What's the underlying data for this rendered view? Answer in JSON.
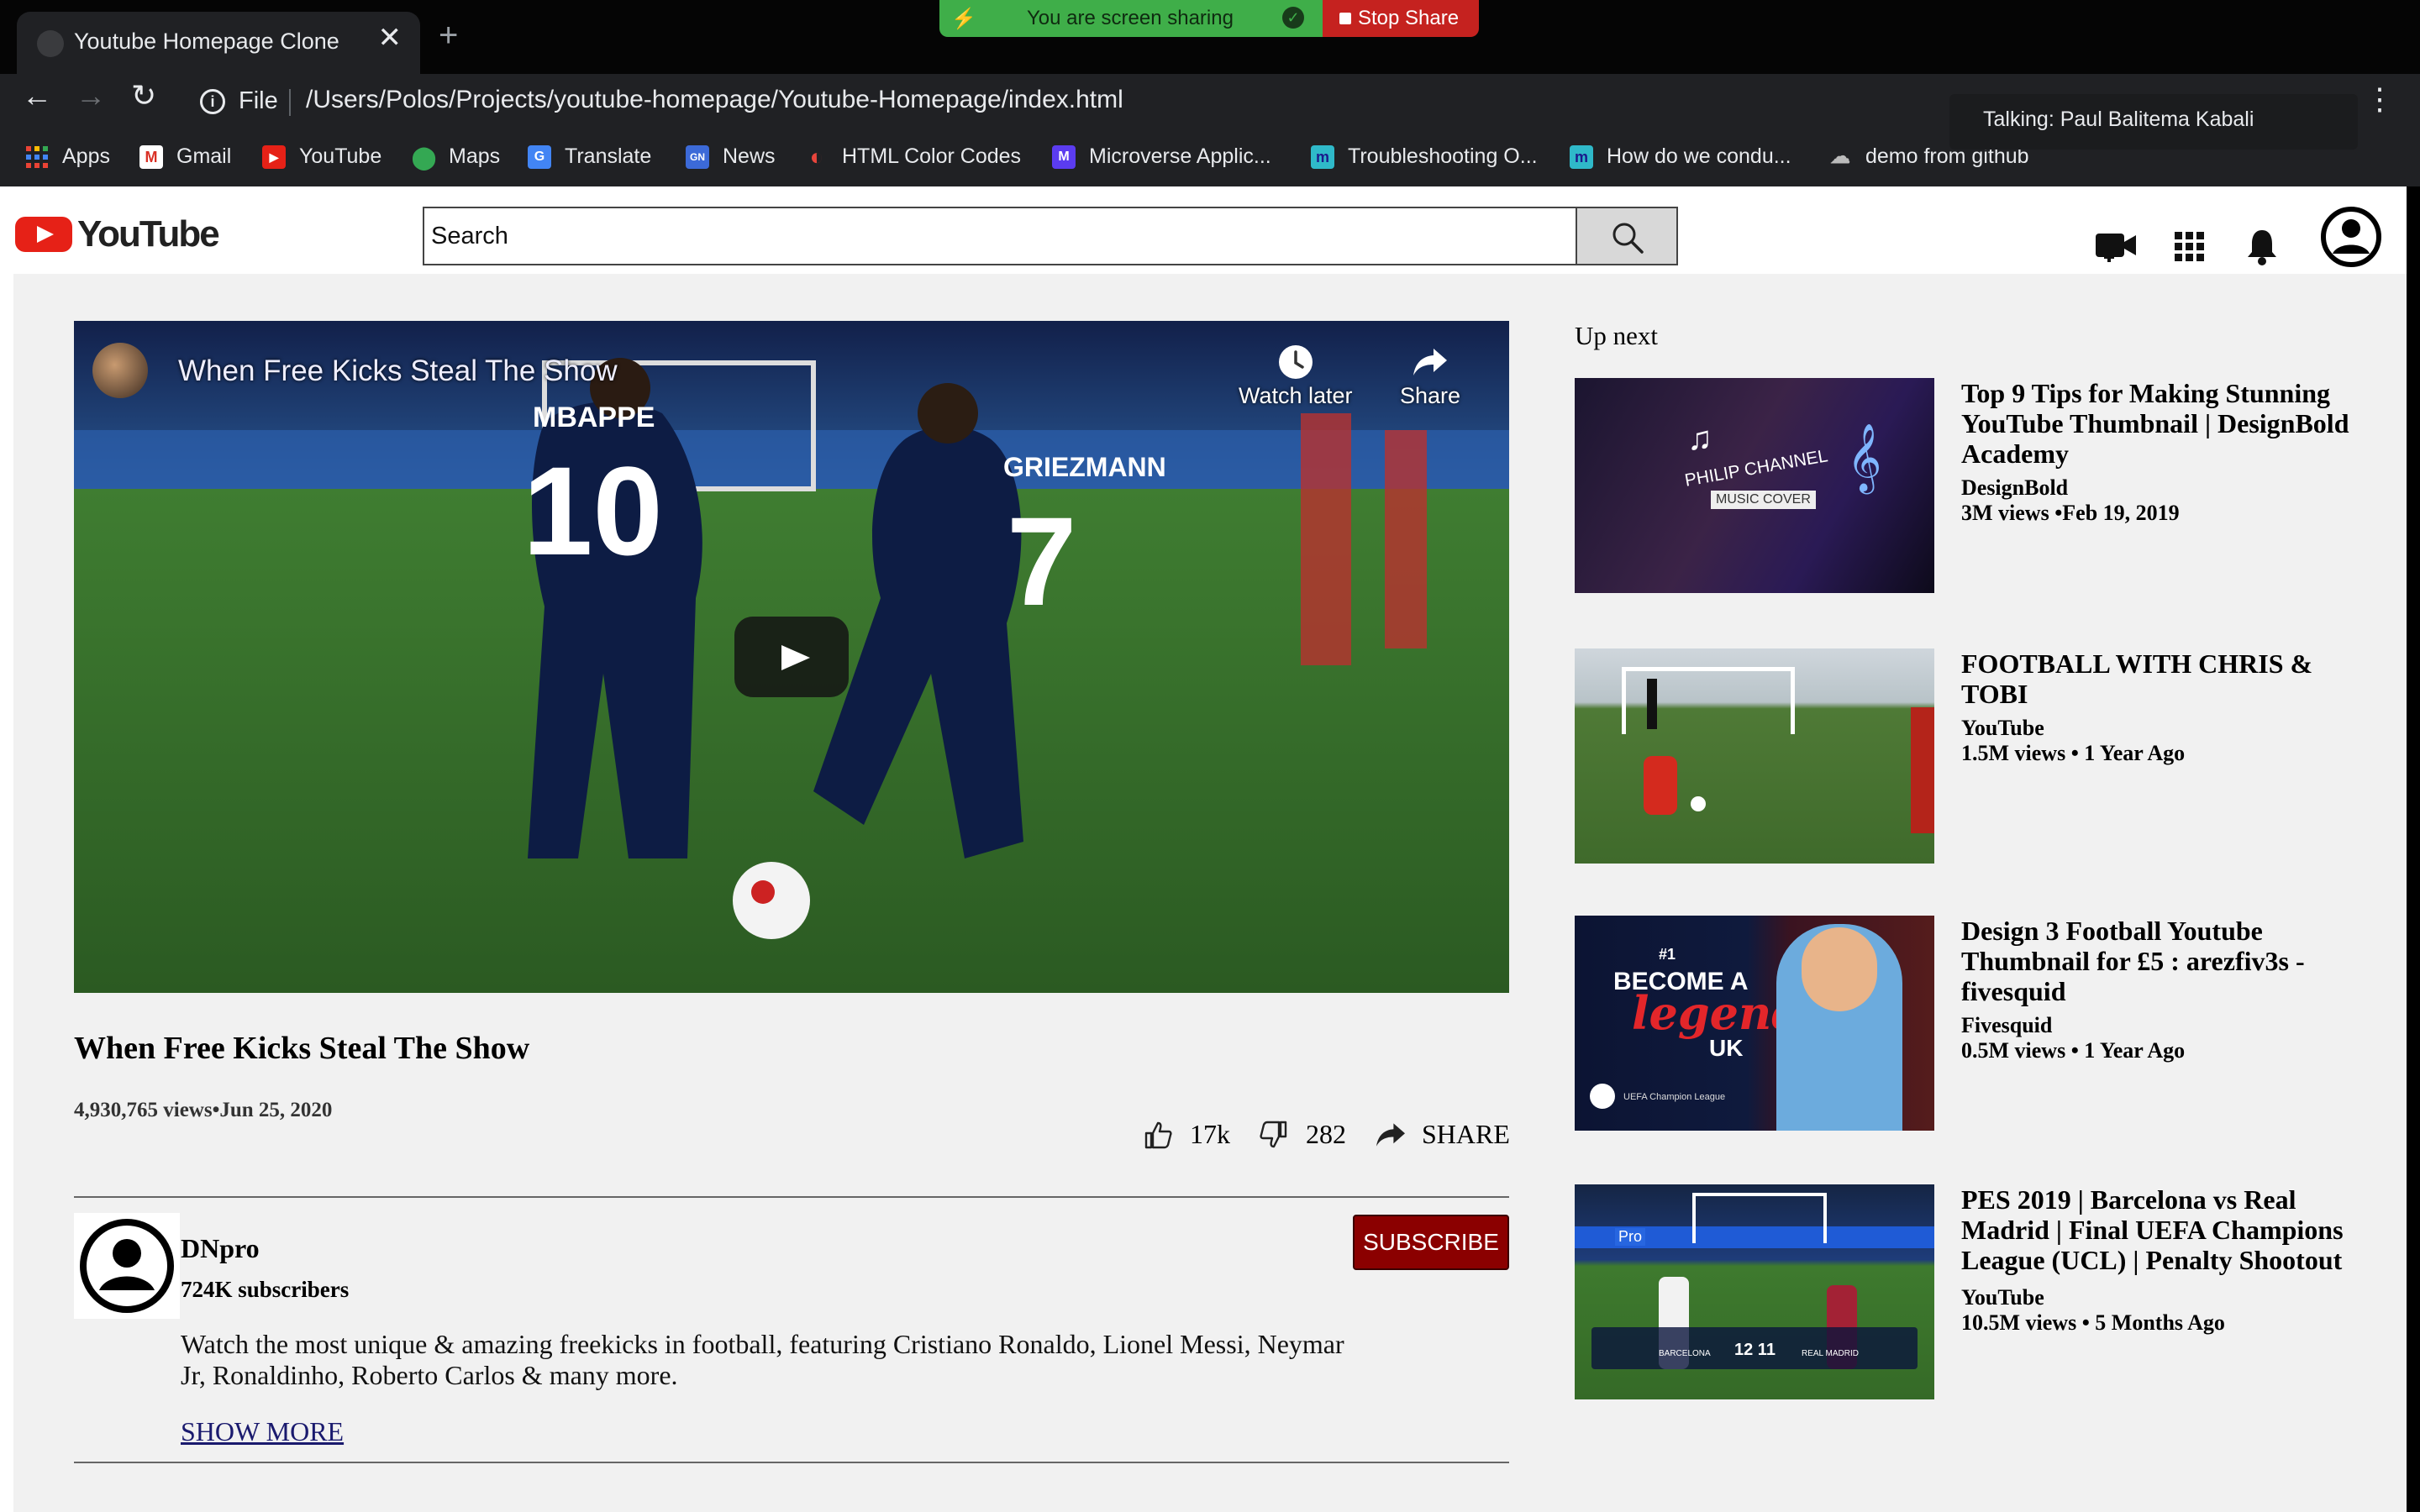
{
  "browser": {
    "tab_title": "Youtube Homepage Clone",
    "tab_close": "✕",
    "new_tab": "+",
    "file_label": "File",
    "url": "/Users/Polos/Projects/youtube-homepage/Youtube-Homepage/index.html",
    "menu": "⋮",
    "screen_share": {
      "status": "You are screen sharing",
      "stop_label": "Stop Share"
    },
    "talking": "Talking: Paul Balitema Kabali",
    "bookmarks": [
      {
        "label": "Apps",
        "icon": "apps-grid-icon"
      },
      {
        "label": "Gmail",
        "icon": "gmail-icon"
      },
      {
        "label": "YouTube",
        "icon": "youtube-icon"
      },
      {
        "label": "Maps",
        "icon": "maps-icon"
      },
      {
        "label": "Translate",
        "icon": "translate-icon"
      },
      {
        "label": "News",
        "icon": "news-icon"
      },
      {
        "label": "HTML Color Codes",
        "icon": "color-icon"
      },
      {
        "label": "Microverse Applic...",
        "icon": "microverse-icon"
      },
      {
        "label": "Troubleshooting O...",
        "icon": "m-icon"
      },
      {
        "label": "How do we condu...",
        "icon": "m-icon"
      },
      {
        "label": "demo from github",
        "icon": "cloud-icon"
      }
    ]
  },
  "header": {
    "logo_text": "YouTube",
    "search_placeholder": "Search"
  },
  "video": {
    "overlay_title": "When Free Kicks Steal The Show",
    "watch_later": "Watch later",
    "share": "Share",
    "jersey_left_name": "MBAPPE",
    "jersey_left_number": "10",
    "jersey_right_name": "GRIEZMANN",
    "jersey_right_number": "7",
    "title": "When Free Kicks Steal The Show",
    "views": "4,930,765 views",
    "date": "Jun 25, 2020",
    "likes": "17k",
    "dislikes": "282",
    "share_label": "SHARE"
  },
  "channel": {
    "name": "DNpro",
    "subscribers": "724K subscribers",
    "subscribe_label": "SUBSCRIBE",
    "description": "Watch the most unique & amazing freekicks in football, featuring Cristiano Ronaldo, Lionel Messi, Neymar Jr, Ronaldinho, Roberto Carlos & many more.",
    "show_more": "SHOW MORE"
  },
  "up_next": {
    "label": "Up next",
    "items": [
      {
        "title": "Top 9 Tips for Making Stunning YouTube Thumbnail | DesignBold Academy",
        "channel": "DesignBold",
        "meta": "3M views •Feb 19, 2019",
        "thumb_text_1": "PHILIP CHANNEL",
        "thumb_text_2": "MUSIC COVER"
      },
      {
        "title": "FOOTBALL WITH CHRIS & TOBI",
        "channel": "YouTube",
        "meta": "1.5M views • 1 Year Ago"
      },
      {
        "title": "Design 3 Football Youtube Thumbnail for £5 : arezfiv3s - fivesquid",
        "channel": "Fivesquid",
        "meta": "0.5M views • 1 Year Ago",
        "thumb_text_1": "#1",
        "thumb_text_2": "BECOME A",
        "thumb_text_3": "legend",
        "thumb_text_4": "UK",
        "thumb_text_5": "UEFA Champion League"
      },
      {
        "title": "PES 2019 | Barcelona vs Real Madrid | Final UEFA Champions League (UCL) | Penalty Shootout",
        "channel": "YouTube",
        "meta": "10.5M views • 5 Months Ago",
        "thumb_text_1": "Pro",
        "thumb_text_2": "12 11",
        "thumb_text_3": "BARCELONA",
        "thumb_text_4": "REAL MADRID"
      }
    ]
  },
  "colors": {
    "youtube_red": "#e62117",
    "subscribe_red": "#8b0000",
    "share_green": "#3fae49",
    "stop_red": "#c5221f"
  }
}
